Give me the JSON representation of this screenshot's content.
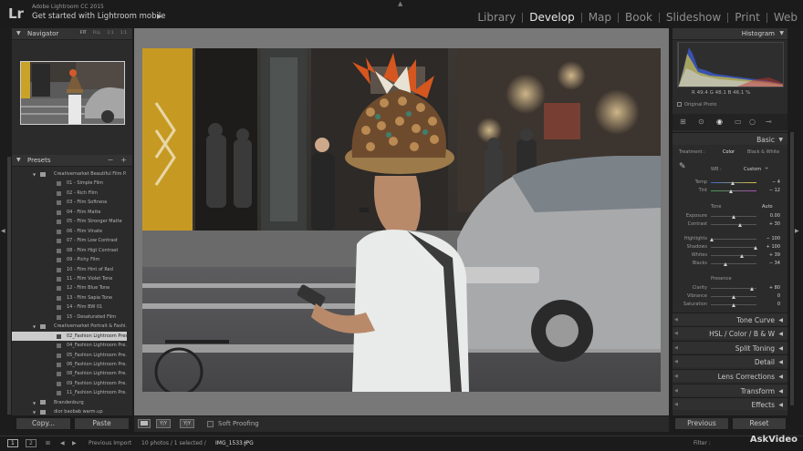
{
  "window": {
    "app_title": "Adobe Lightroom CC 2015",
    "subtitle": "Get started with Lightroom mobile",
    "logo": "Lr"
  },
  "modules": [
    "Library",
    "Develop",
    "Map",
    "Book",
    "Slideshow",
    "Print",
    "Web"
  ],
  "active_module": "Develop",
  "navigator": {
    "title": "Navigator",
    "options": [
      "FIT",
      "FILL",
      "1:1",
      "1:1"
    ]
  },
  "presets": {
    "title": "Presets",
    "items": [
      {
        "type": "folder",
        "label": "Creativemarket Beautiful Film P..."
      },
      {
        "type": "item",
        "label": "01 - Simple Film"
      },
      {
        "type": "item",
        "label": "02 - Rich Film"
      },
      {
        "type": "item",
        "label": "03 - Film Softness"
      },
      {
        "type": "item",
        "label": "04 - Film Matte"
      },
      {
        "type": "item",
        "label": "05 - Film Stronger Matte"
      },
      {
        "type": "item",
        "label": "06 - Film Vinate"
      },
      {
        "type": "item",
        "label": "07 - Film Low Contrast"
      },
      {
        "type": "item",
        "label": "08 - Film Higt Contrast"
      },
      {
        "type": "item",
        "label": "09 - Pichy Film"
      },
      {
        "type": "item",
        "label": "10 - Film Hint of Red"
      },
      {
        "type": "item",
        "label": "11 - Film Violet Tone"
      },
      {
        "type": "item",
        "label": "12 - Film Blue Tone"
      },
      {
        "type": "item",
        "label": "13 - Film Sapia Tone"
      },
      {
        "type": "item",
        "label": "14 - Film BW 01"
      },
      {
        "type": "item",
        "label": "15 - Desaturated Film"
      },
      {
        "type": "folder",
        "label": "Creativemarket Portrait & Fashi..."
      },
      {
        "type": "item",
        "label": "02_Fashion Lightroom Preset",
        "selected": true
      },
      {
        "type": "item",
        "label": "04_Fashion Lightroom Pre..."
      },
      {
        "type": "item",
        "label": "05_Fashion Lightroom Pre..."
      },
      {
        "type": "item",
        "label": "06_Fashion Lightroom Pre..."
      },
      {
        "type": "item",
        "label": "08_Fashion Lightroom Pre..."
      },
      {
        "type": "item",
        "label": "09_Fashion Lightroom Pre..."
      },
      {
        "type": "item",
        "label": "11_Fashion Lightroom Pre..."
      },
      {
        "type": "folder",
        "label": "Brandenburg"
      },
      {
        "type": "folder",
        "label": "dior baobab warm.up"
      }
    ]
  },
  "left_buttons": {
    "copy": "Copy...",
    "paste": "Paste"
  },
  "toolbar": {
    "soft_proofing": "Soft Proofing"
  },
  "histogram": {
    "title": "Histogram",
    "readout": "R  49.4  G  48.1  B  46.1 %",
    "original_photo": "Original Photo"
  },
  "basic": {
    "title": "Basic",
    "treatment_label": "Treatment :",
    "treatment_color": "Color",
    "treatment_bw": "Black & White",
    "wb_label": "WB :",
    "wb_value": "Custom",
    "tone_label": "Tone",
    "tone_auto": "Auto",
    "presence_label": "Presence",
    "sliders": [
      {
        "name": "temp",
        "label": "Temp",
        "value": "− 4",
        "pos": 0.49
      },
      {
        "name": "tint",
        "label": "Tint",
        "value": "− 12",
        "pos": 0.44
      },
      {
        "name": "exposure",
        "label": "Exposure",
        "value": "0.00",
        "pos": 0.5
      },
      {
        "name": "contrast",
        "label": "Contrast",
        "value": "+ 30",
        "pos": 0.65
      },
      {
        "name": "highlights",
        "label": "Highlights",
        "value": "− 100",
        "pos": 0.02
      },
      {
        "name": "shadows",
        "label": "Shadows",
        "value": "+ 100",
        "pos": 0.98
      },
      {
        "name": "whites",
        "label": "Whites",
        "value": "+ 39",
        "pos": 0.69
      },
      {
        "name": "blacks",
        "label": "Blacks",
        "value": "− 34",
        "pos": 0.33
      },
      {
        "name": "clarity",
        "label": "Clarity",
        "value": "+ 80",
        "pos": 0.9
      },
      {
        "name": "vibrance",
        "label": "Vibrance",
        "value": "0",
        "pos": 0.5
      },
      {
        "name": "saturation",
        "label": "Saturation",
        "value": "0",
        "pos": 0.5
      }
    ]
  },
  "sections": [
    {
      "name": "tone-curve",
      "label": "Tone Curve"
    },
    {
      "name": "hsl",
      "label": "HSL  /  Color  /  B & W"
    },
    {
      "name": "split-toning",
      "label": "Split Toning"
    },
    {
      "name": "detail",
      "label": "Detail"
    },
    {
      "name": "lens-corrections",
      "label": "Lens Corrections"
    },
    {
      "name": "transform",
      "label": "Transform"
    },
    {
      "name": "effects",
      "label": "Effects"
    }
  ],
  "right_buttons": {
    "previous": "Previous",
    "reset": "Reset"
  },
  "filmstrip": {
    "page1": "1",
    "page2": "2",
    "previous_import": "Previous Import",
    "count": "10 photos / 1 selected /",
    "filename": "IMG_1533.JPG",
    "filter_label": "Filter :"
  },
  "watermark": "AskVideo"
}
